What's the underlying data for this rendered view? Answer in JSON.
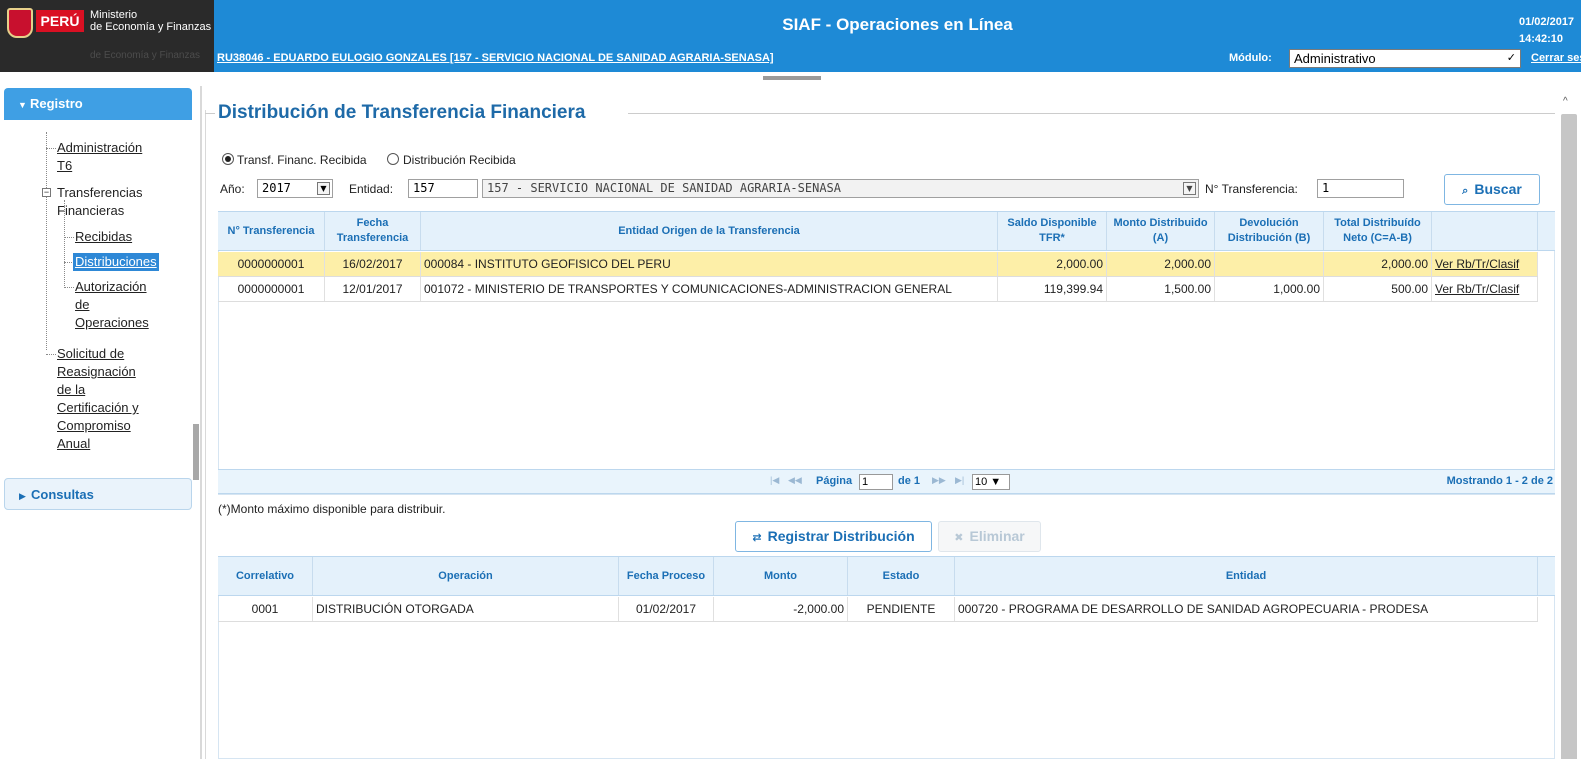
{
  "header": {
    "logo": {
      "country": "PERÚ",
      "ministry_line1": "Ministerio",
      "ministry_line2": "de Economía y Finanzas",
      "tagline": "de Economía y Finanzas"
    },
    "title": "SIAF - Operaciones en Línea",
    "date": "01/02/2017",
    "time": "14:42:10",
    "user": "RU38046 - EDUARDO EULOGIO GONZALES [157 - SERVICIO NACIONAL DE SANIDAD AGRARIA-SENASA]",
    "module_label": "Módulo:",
    "module_value": "Administrativo",
    "logout": "Cerrar sesión"
  },
  "sidebar": {
    "registro": "Registro",
    "consultas": "Consultas",
    "items": {
      "administracion": [
        "Administración",
        "T6"
      ],
      "transferencias": [
        "Transferencias",
        "Financieras"
      ],
      "recibidas": "Recibidas",
      "distribuciones": "Distribuciones",
      "autorizacion": [
        "Autorización",
        "de",
        "Operaciones"
      ],
      "solicitud": [
        "Solicitud de",
        "Reasignación",
        "de la",
        "Certificación y",
        "Compromiso",
        "Anual"
      ]
    }
  },
  "page": {
    "title": "Distribución de Transferencia Financiera",
    "radio_recibida": "Transf. Financ. Recibida",
    "radio_distribucion": "Distribución Recibida",
    "anio_label": "Año:",
    "anio_value": "2017",
    "entidad_label": "Entidad:",
    "entidad_code": "157",
    "entidad_name": "157 - SERVICIO NACIONAL DE SANIDAD AGRARIA-SENASA",
    "ntransf_label": "N° Transferencia:",
    "ntransf_value": "1",
    "buscar": "Buscar",
    "footnote": "(*)Monto máximo disponible para distribuir.",
    "registrar": "Registrar Distribución",
    "eliminar": "Eliminar"
  },
  "grid1": {
    "headers": {
      "h0": "N° Transferencia",
      "h1": "Fecha Transferencia",
      "h2": "Entidad Origen de la Transferencia",
      "h3": "Saldo Disponible TFR*",
      "h4": "Monto Distribuido (A)",
      "h5": "Devolución Distribución (B)",
      "h6": "Total Distribuído Neto (C=A-B)"
    },
    "rows": [
      {
        "ntransf": "0000000001",
        "fecha": "16/02/2017",
        "entidad": "000084 - INSTITUTO GEOFISICO DEL PERU",
        "saldo": "2,000.00",
        "monto": "2,000.00",
        "devolucion": "",
        "total": "2,000.00",
        "link": "Ver Rb/Tr/Clasif"
      },
      {
        "ntransf": "0000000001",
        "fecha": "12/01/2017",
        "entidad": "001072 - MINISTERIO DE TRANSPORTES Y COMUNICACIONES-ADMINISTRACION GENERAL",
        "saldo": "119,399.94",
        "monto": "1,500.00",
        "devolucion": "1,000.00",
        "total": "500.00",
        "link": "Ver Rb/Tr/Clasif"
      }
    ],
    "pager": {
      "pagina_label": "Página",
      "page": "1",
      "de_label": "de 1",
      "page_size": "10",
      "showing": "Mostrando 1 - 2 de 2"
    }
  },
  "grid2": {
    "headers": {
      "h0": "Correlativo",
      "h1": "Operación",
      "h2": "Fecha Proceso",
      "h3": "Monto",
      "h4": "Estado",
      "h5": "Entidad"
    },
    "rows": [
      {
        "correlativo": "0001",
        "operacion": "DISTRIBUCIÓN OTORGADA",
        "fecha": "01/02/2017",
        "monto": "-2,000.00",
        "estado": "PENDIENTE",
        "entidad": "000720 - PROGRAMA DE DESARROLLO DE SANIDAD AGROPECUARIA - PRODESA"
      }
    ]
  },
  "colors": {
    "header_blue": "#1e8ad6",
    "accent_blue": "#1b6fb5",
    "selected_row": "#fdefa8"
  }
}
